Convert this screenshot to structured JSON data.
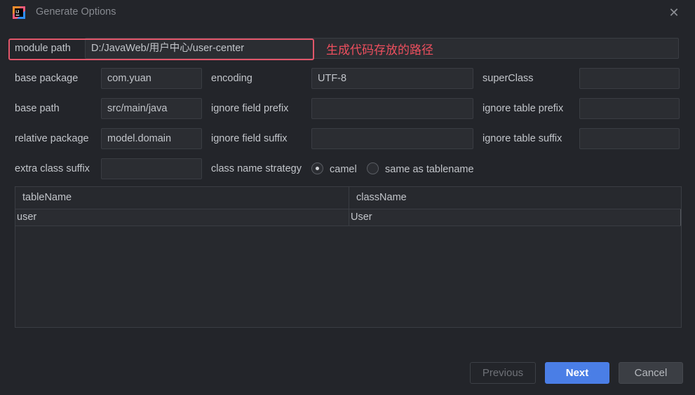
{
  "window": {
    "title": "Generate Options",
    "close_icon": "✕"
  },
  "annotation": {
    "text": "生成代码存放的路径",
    "color": "#ee4f5e"
  },
  "form": {
    "module_path": {
      "label": "module path",
      "value": "D:/JavaWeb/用户中心/user-center"
    },
    "base_package": {
      "label": "base package",
      "value": "com.yuan"
    },
    "base_path": {
      "label": "base path",
      "value": "src/main/java"
    },
    "relative_package": {
      "label": "relative package",
      "value": "model.domain"
    },
    "extra_class_suffix": {
      "label": "extra class suffix",
      "value": ""
    },
    "encoding": {
      "label": "encoding",
      "value": "UTF-8"
    },
    "ignore_field_prefix": {
      "label": "ignore field prefix",
      "value": ""
    },
    "ignore_field_suffix": {
      "label": "ignore field suffix",
      "value": ""
    },
    "class_name_strategy": {
      "label": "class name strategy",
      "options": [
        "camel",
        "same as tablename"
      ],
      "selected": "camel"
    },
    "super_class": {
      "label": "superClass",
      "value": ""
    },
    "ignore_table_prefix": {
      "label": "ignore table prefix",
      "value": ""
    },
    "ignore_table_suffix": {
      "label": "ignore table suffix",
      "value": ""
    }
  },
  "table": {
    "headers": [
      "tableName",
      "className"
    ],
    "rows": [
      [
        "user",
        "User"
      ]
    ]
  },
  "buttons": {
    "previous": "Previous",
    "next": "Next",
    "cancel": "Cancel"
  },
  "colors": {
    "accent": "#4a7ee6",
    "background": "#23252a",
    "highlight_border": "#e2566a"
  }
}
